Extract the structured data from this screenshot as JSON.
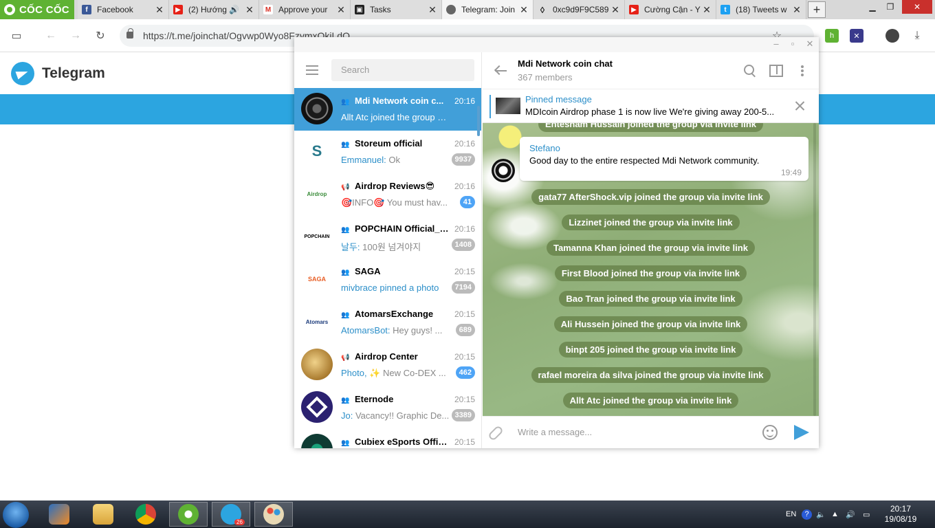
{
  "browser": {
    "brand": "CỐC CỐC",
    "tabs": [
      {
        "title": "Facebook",
        "icon": "facebook-icon"
      },
      {
        "title": "(2) Hướng",
        "icon": "youtube-icon"
      },
      {
        "title": "Approve your",
        "icon": "gmail-icon"
      },
      {
        "title": "Tasks",
        "icon": "tasks-icon"
      },
      {
        "title": "Telegram: Join",
        "icon": "globe-icon"
      },
      {
        "title": "0xc9d9F9C589",
        "icon": "ethereum-icon"
      },
      {
        "title": "Cường Cận - Y",
        "icon": "youtube-icon"
      },
      {
        "title": "(18) Tweets w",
        "icon": "twitter-icon"
      }
    ],
    "url": "https://t.me/joinchat/Ogvwp0Wyo8FzymxQkiLdQ"
  },
  "page": {
    "brand": "Telegram"
  },
  "telegram": {
    "search_placeholder": "Search",
    "chats": [
      {
        "name": "Mdi Network coin c...",
        "kind": "group",
        "time": "20:16",
        "from": "",
        "preview": "Allt Atc joined the group via inv...",
        "badge": "",
        "selected": true,
        "avatar_color": "#222222",
        "avatar_text": ""
      },
      {
        "name": "Storeum official",
        "kind": "group",
        "time": "20:16",
        "from": "Emmanuel:",
        "preview": " Ok",
        "badge": "9937",
        "avatar_color": "#ffffff",
        "avatar_text": "S"
      },
      {
        "name": "Airdrop Reviews😎",
        "kind": "channel",
        "time": "20:16",
        "from": "",
        "preview": "🎯INFO🎯 You must hav...",
        "badge": "41",
        "badge_blue": true,
        "avatar_color": "#ffffff",
        "avatar_text": "Airdrop"
      },
      {
        "name": "POPCHAIN Official_KR",
        "kind": "group",
        "time": "20:16",
        "from": "날두:",
        "preview": " 100원 넘겨야지",
        "badge": "1408",
        "avatar_color": "#ffffff",
        "avatar_text": "POPCHAIN"
      },
      {
        "name": "SAGA",
        "kind": "group",
        "time": "20:15",
        "from": "mivbrace pinned a photo",
        "preview": "",
        "badge": "7194",
        "avatar_color": "#ffffff",
        "avatar_text": "SAGA"
      },
      {
        "name": "AtomarsExchange",
        "kind": "group",
        "time": "20:15",
        "from": "AtomarsBot:",
        "preview": " Hey guys! ...",
        "badge": "689",
        "avatar_color": "#ffffff",
        "avatar_text": "Atomars"
      },
      {
        "name": "Airdrop Center",
        "kind": "channel",
        "time": "20:15",
        "from": "Photo,",
        "preview": " ✨ New Co-DEX ...",
        "badge": "462",
        "badge_blue": true,
        "avatar_color": "#b88a3c",
        "avatar_text": ""
      },
      {
        "name": "Eternode",
        "kind": "group",
        "time": "20:15",
        "from": "Jo:",
        "preview": " Vacancy!! Graphic De...",
        "badge": "3389",
        "avatar_color": "#2b2170",
        "avatar_text": ""
      },
      {
        "name": "Cubiex eSports Offic...",
        "kind": "group",
        "time": "20:15",
        "from": "",
        "preview": "",
        "badge": "",
        "avatar_color": "#0f3b33",
        "avatar_text": ""
      }
    ],
    "header": {
      "title": "Mdi Network coin chat",
      "subtitle": "367 members"
    },
    "pinned": {
      "label": "Pinned message",
      "text": "MDIcoin Airdrop phase 1 is now live We're giving away 200-5..."
    },
    "top_cut_service": "Ehtesham Hussain joined the group via invite link",
    "message": {
      "sender": "Stefano",
      "text": "Good day to the entire respected Mdi Network community.",
      "time": "19:49"
    },
    "service_messages": [
      "gata77 AfterShock.vip joined the group via invite link",
      "Lizzinet joined the group via invite link",
      "Tamanna Khan joined the group via invite link",
      "First Blood joined the group via invite link",
      "Bao Tran joined the group via invite link",
      "Ali Hussein joined the group via invite link",
      "binpt 205 joined the group via invite link",
      "rafael moreira da silva joined the group via invite link",
      "Allt Atc joined the group via invite link"
    ],
    "compose_placeholder": "Write a message..."
  },
  "taskbar": {
    "lang": "EN",
    "time": "20:17",
    "date": "19/08/19",
    "telegram_badge": "26"
  }
}
